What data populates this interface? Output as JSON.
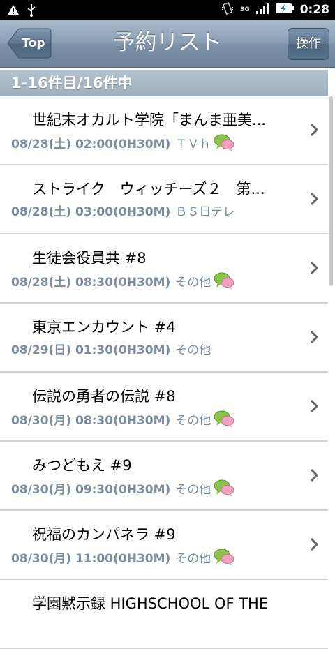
{
  "status_bar": {
    "time": "0:28",
    "network": "3G",
    "icons": [
      "warning-icon",
      "usb-icon",
      "vibrate-icon",
      "signal-icon",
      "battery-charging-icon"
    ]
  },
  "header": {
    "back_label": "Top",
    "title": "予約リスト",
    "action_label": "操作"
  },
  "section_header": "1-16件目/16件中",
  "list": {
    "items": [
      {
        "title": "世紀末オカルト学院「まんま亜美...",
        "date": "08/28(土) 02:00(0H30M)",
        "channel": "ＴＶｈ",
        "has_comment": true
      },
      {
        "title": "ストライク　ウィッチーズ２　第...",
        "date": "08/28(土) 03:00(0H30M)",
        "channel": "ＢＳ日テレ",
        "has_comment": false
      },
      {
        "title": "生徒会役員共 #8",
        "date": "08/28(土) 08:30(0H30M)",
        "channel": "その他",
        "has_comment": true
      },
      {
        "title": "東京エンカウント #4",
        "date": "08/29(日) 01:30(0H30M)",
        "channel": "その他",
        "has_comment": false
      },
      {
        "title": "伝説の勇者の伝説 #8",
        "date": "08/30(月) 08:30(0H30M)",
        "channel": "その他",
        "has_comment": true
      },
      {
        "title": "みつどもえ #9",
        "date": "08/30(月) 09:30(0H30M)",
        "channel": "その他",
        "has_comment": true
      },
      {
        "title": "祝福のカンパネラ #9",
        "date": "08/30(月) 11:00(0H30M)",
        "channel": "その他",
        "has_comment": true
      },
      {
        "title": "学園黙示録 HIGHSCHOOL OF THE",
        "date": "",
        "channel": "",
        "has_comment": false
      }
    ]
  },
  "colors": {
    "header_blue": "#8ea2b7",
    "meta_text": "#7a8da0",
    "comment_icon_green": "#8bc34a",
    "comment_icon_pink": "#f2a0c0"
  }
}
